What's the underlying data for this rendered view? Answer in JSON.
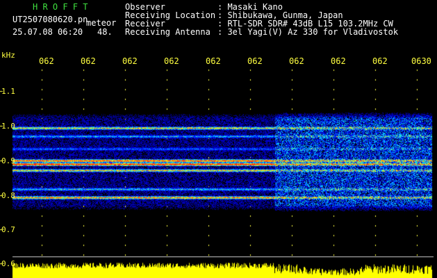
{
  "header": {
    "app_name": "H R O F F T",
    "filename": "UT2507080620.pn",
    "suffix": "meteor",
    "datetime": "25.07.08 06:20",
    "count": "48.",
    "info_labels": [
      "Observer",
      "Receiving Location",
      "Receiver",
      "Receiving Antenna"
    ],
    "info_values": [
      ": Masaki Kano",
      ": Shibukawa, Gunma, Japan",
      ": RTL-SDR SDR# 43dB L15 103.2MHz CW",
      ": 3el Yagi(V) Az 330 for Vladivostok"
    ]
  },
  "axis": {
    "freq_unit": "kHz",
    "freq_ticks": [
      "1.1",
      "1.0",
      "0.9",
      "0.8",
      "0.7",
      "0.6"
    ],
    "time_ticks": [
      "062",
      "062",
      "062",
      "062",
      "062",
      "062",
      "062",
      "062",
      "062",
      "0630"
    ]
  },
  "colors": {
    "background": "#000000",
    "text": "#ffffff",
    "app_name": "#3fe03f",
    "axis_labels": "#ffff40",
    "amplitude": "#ffff00"
  }
}
